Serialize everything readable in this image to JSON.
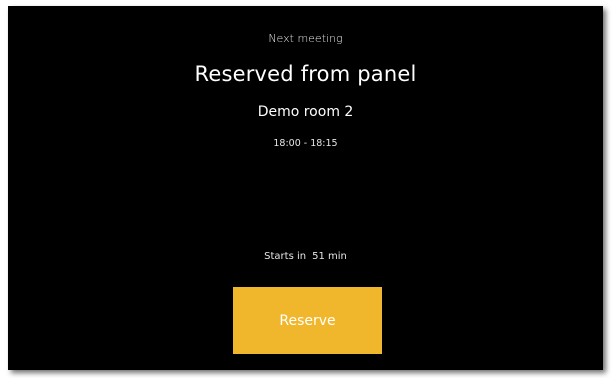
{
  "next_meeting": {
    "label": "Next meeting",
    "title": "Reserved from panel",
    "room": "Demo room 2",
    "time_range": "18:00 - 18:15"
  },
  "countdown": {
    "prefix": "Starts in",
    "value": "51 min"
  },
  "actions": {
    "reserve_label": "Reserve"
  },
  "colors": {
    "background": "#000000",
    "accent": "#f1b72c",
    "text": "#ffffff"
  }
}
